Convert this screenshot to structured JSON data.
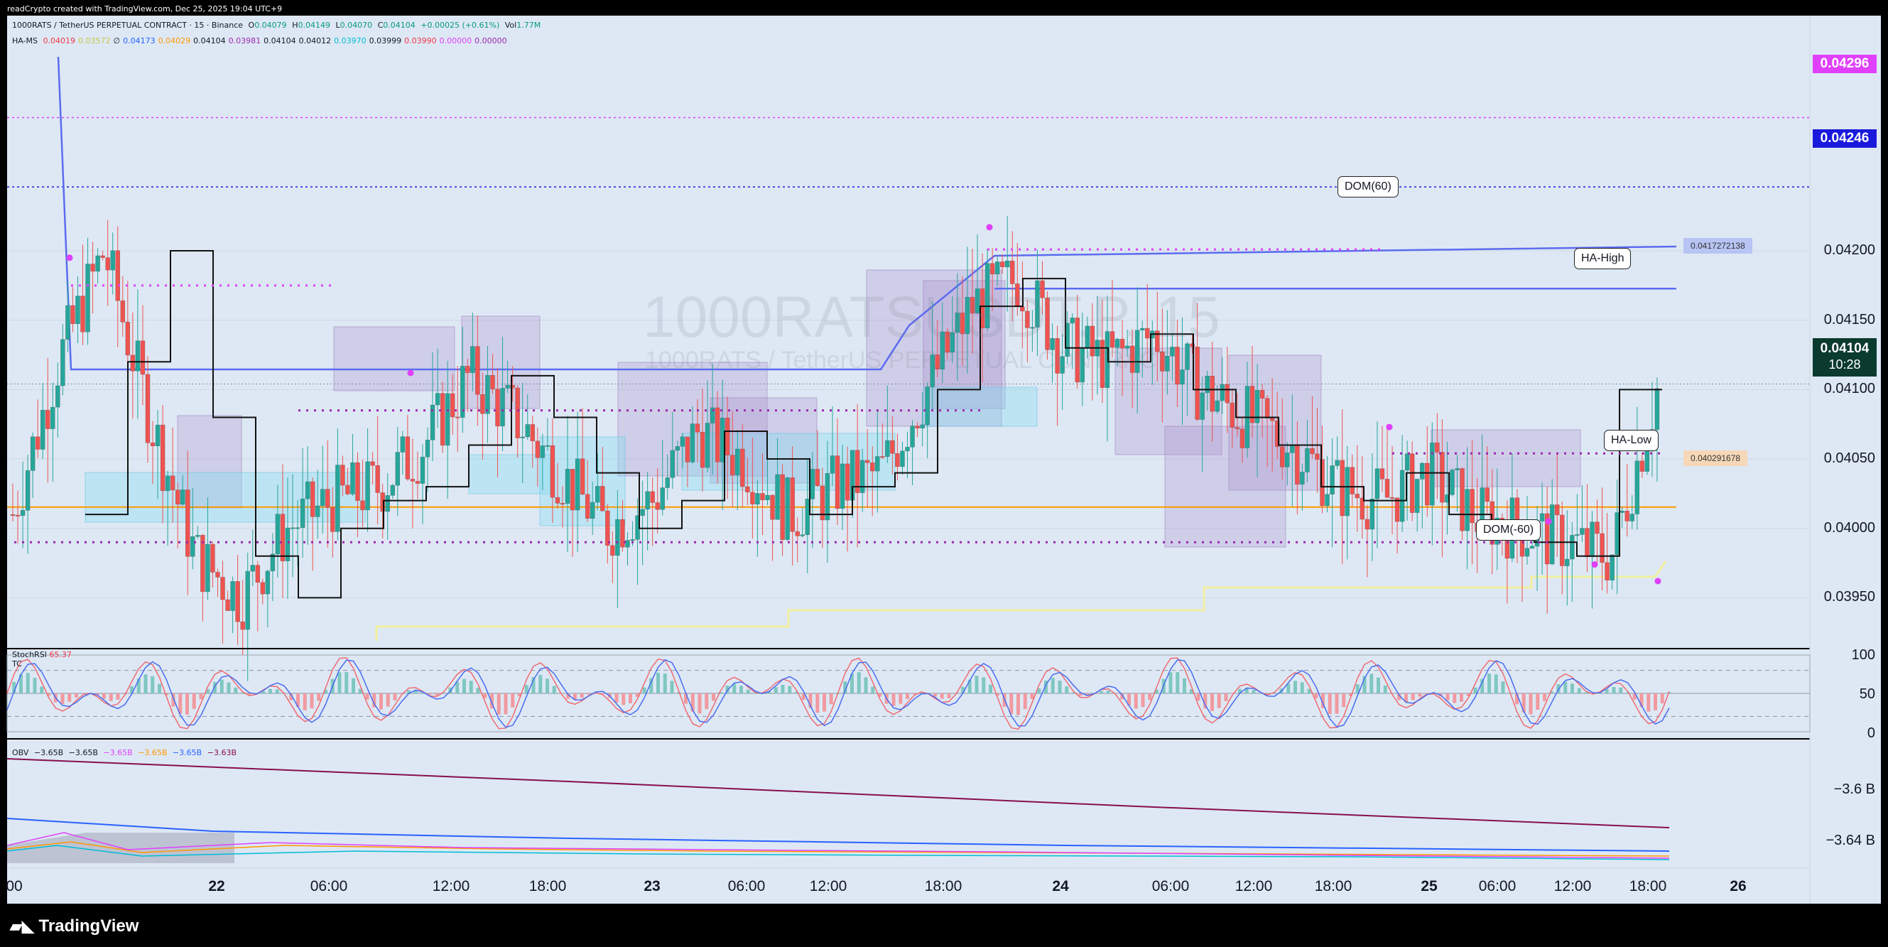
{
  "credit": "readCrypto created with TradingView.com, Dec 25, 2025 19:04 UTC+9",
  "header": {
    "symbol": "1000RATS / TetherUS PERPETUAL CONTRACT · 15 · Binance",
    "o_label": "O",
    "o": "0.04079",
    "h_label": "H",
    "h": "0.04149",
    "l_label": "L",
    "l": "0.04070",
    "c_label": "C",
    "c": "0.04104",
    "change": "+0.00025 (+0.61%)",
    "vol_label": "Vol",
    "vol": "1.77M",
    "hams_label": "HA-MS",
    "hams_values": [
      {
        "v": "0.04019",
        "color": "#f23645"
      },
      {
        "v": "0.03572",
        "color": "#c9c44a"
      },
      {
        "v": "∅",
        "color": "#131722"
      },
      {
        "v": "0.04173",
        "color": "#2962ff"
      },
      {
        "v": "0.04029",
        "color": "#ff9800"
      },
      {
        "v": "0.04104",
        "color": "#131722"
      },
      {
        "v": "0.03981",
        "color": "#9c27b0"
      },
      {
        "v": "0.04104",
        "color": "#131722"
      },
      {
        "v": "0.04012",
        "color": "#131722"
      },
      {
        "v": "0.03970",
        "color": "#00bcd4"
      },
      {
        "v": "0.03999",
        "color": "#131722"
      },
      {
        "v": "0.03990",
        "color": "#f23645"
      },
      {
        "v": "0.00000",
        "color": "#e040fb"
      },
      {
        "v": "0.00000",
        "color": "#9c27b0"
      }
    ]
  },
  "watermark": {
    "main": "1000RATSUSDT.P, 15",
    "sub": "1000RATS / TetherUS PERPETUAL CONTRACT"
  },
  "price_labels": {
    "p1": "0.04296",
    "p2": "0.04246",
    "current": "0.04104",
    "countdown": "10:28"
  },
  "tags": {
    "dom_pos": "DOM(60)",
    "dom_neg": "DOM(-60)",
    "ha_high": "HA-High",
    "ha_low": "HA-Low",
    "ha_high_price": "0.0417272138",
    "ha_low_price": "0.040291678"
  },
  "stoch": {
    "label": "StochRSI",
    "value": "65.37",
    "tc": "TC",
    "ticks": [
      "100",
      "50",
      "0"
    ]
  },
  "obv": {
    "label": "OBV",
    "values": [
      {
        "v": "−3.65B",
        "color": "#131722"
      },
      {
        "v": "−3.65B",
        "color": "#131722"
      },
      {
        "v": "−3.65B",
        "color": "#e040fb"
      },
      {
        "v": "−3.65B",
        "color": "#ff9800"
      },
      {
        "v": "−3.65B",
        "color": "#2962ff"
      },
      {
        "v": "−3.63B",
        "color": "#880e4f"
      }
    ],
    "ticks": [
      "−3.6 B",
      "−3.64 B"
    ]
  },
  "footer": {
    "logo": "TradingView"
  },
  "colors": {
    "background": "#dde8f4",
    "pane_border": "#000000",
    "up": "#26a69a",
    "down": "#ef5350",
    "ha_high_line": "#5c6bf0",
    "orange_line": "#ff9800",
    "dom_dots": "#9c27b0",
    "pink_dots": "#e040fb"
  },
  "chart_data": {
    "type": "line",
    "title": "1000RATS / TetherUS PERPETUAL CONTRACT · 15 · Binance",
    "y_ticks": [
      "0.04200",
      "0.04150",
      "0.04100",
      "0.04050",
      "0.04000",
      "0.03950"
    ],
    "x_ticks": [
      "00",
      "22",
      "06:00",
      "12:00",
      "18:00",
      "23",
      "06:00",
      "12:00",
      "18:00",
      "24",
      "06:00",
      "12:00",
      "18:00",
      "25",
      "06:00",
      "12:00",
      "18:00",
      "26"
    ],
    "ylim": [
      0.0392,
      0.0435
    ],
    "levels": {
      "pink_dotted": 0.04296,
      "blue_dotted": 0.04246,
      "ha_high": 0.0417272138,
      "ha_low": 0.040291678,
      "current": 0.04104
    },
    "series": [
      {
        "name": "HA-MS close",
        "values": [
          0.0401,
          0.0412,
          0.042,
          0.0408,
          0.0398,
          0.0395,
          0.04,
          0.0402,
          0.0403,
          0.0406,
          0.0411,
          0.0408,
          0.0404,
          0.04,
          0.0402,
          0.0407,
          0.0405,
          0.0401,
          0.0403,
          0.0404,
          0.041,
          0.0416,
          0.0418,
          0.0413,
          0.0412,
          0.0414,
          0.041,
          0.0408,
          0.0406,
          0.0403,
          0.0402,
          0.0404,
          0.0401,
          0.04,
          0.0399,
          0.0398,
          0.041
        ]
      }
    ],
    "stoch_rsi": {
      "ylim": [
        0,
        100
      ],
      "k": 65.37
    },
    "obv": {
      "unit": "B",
      "last": -3.63
    }
  }
}
